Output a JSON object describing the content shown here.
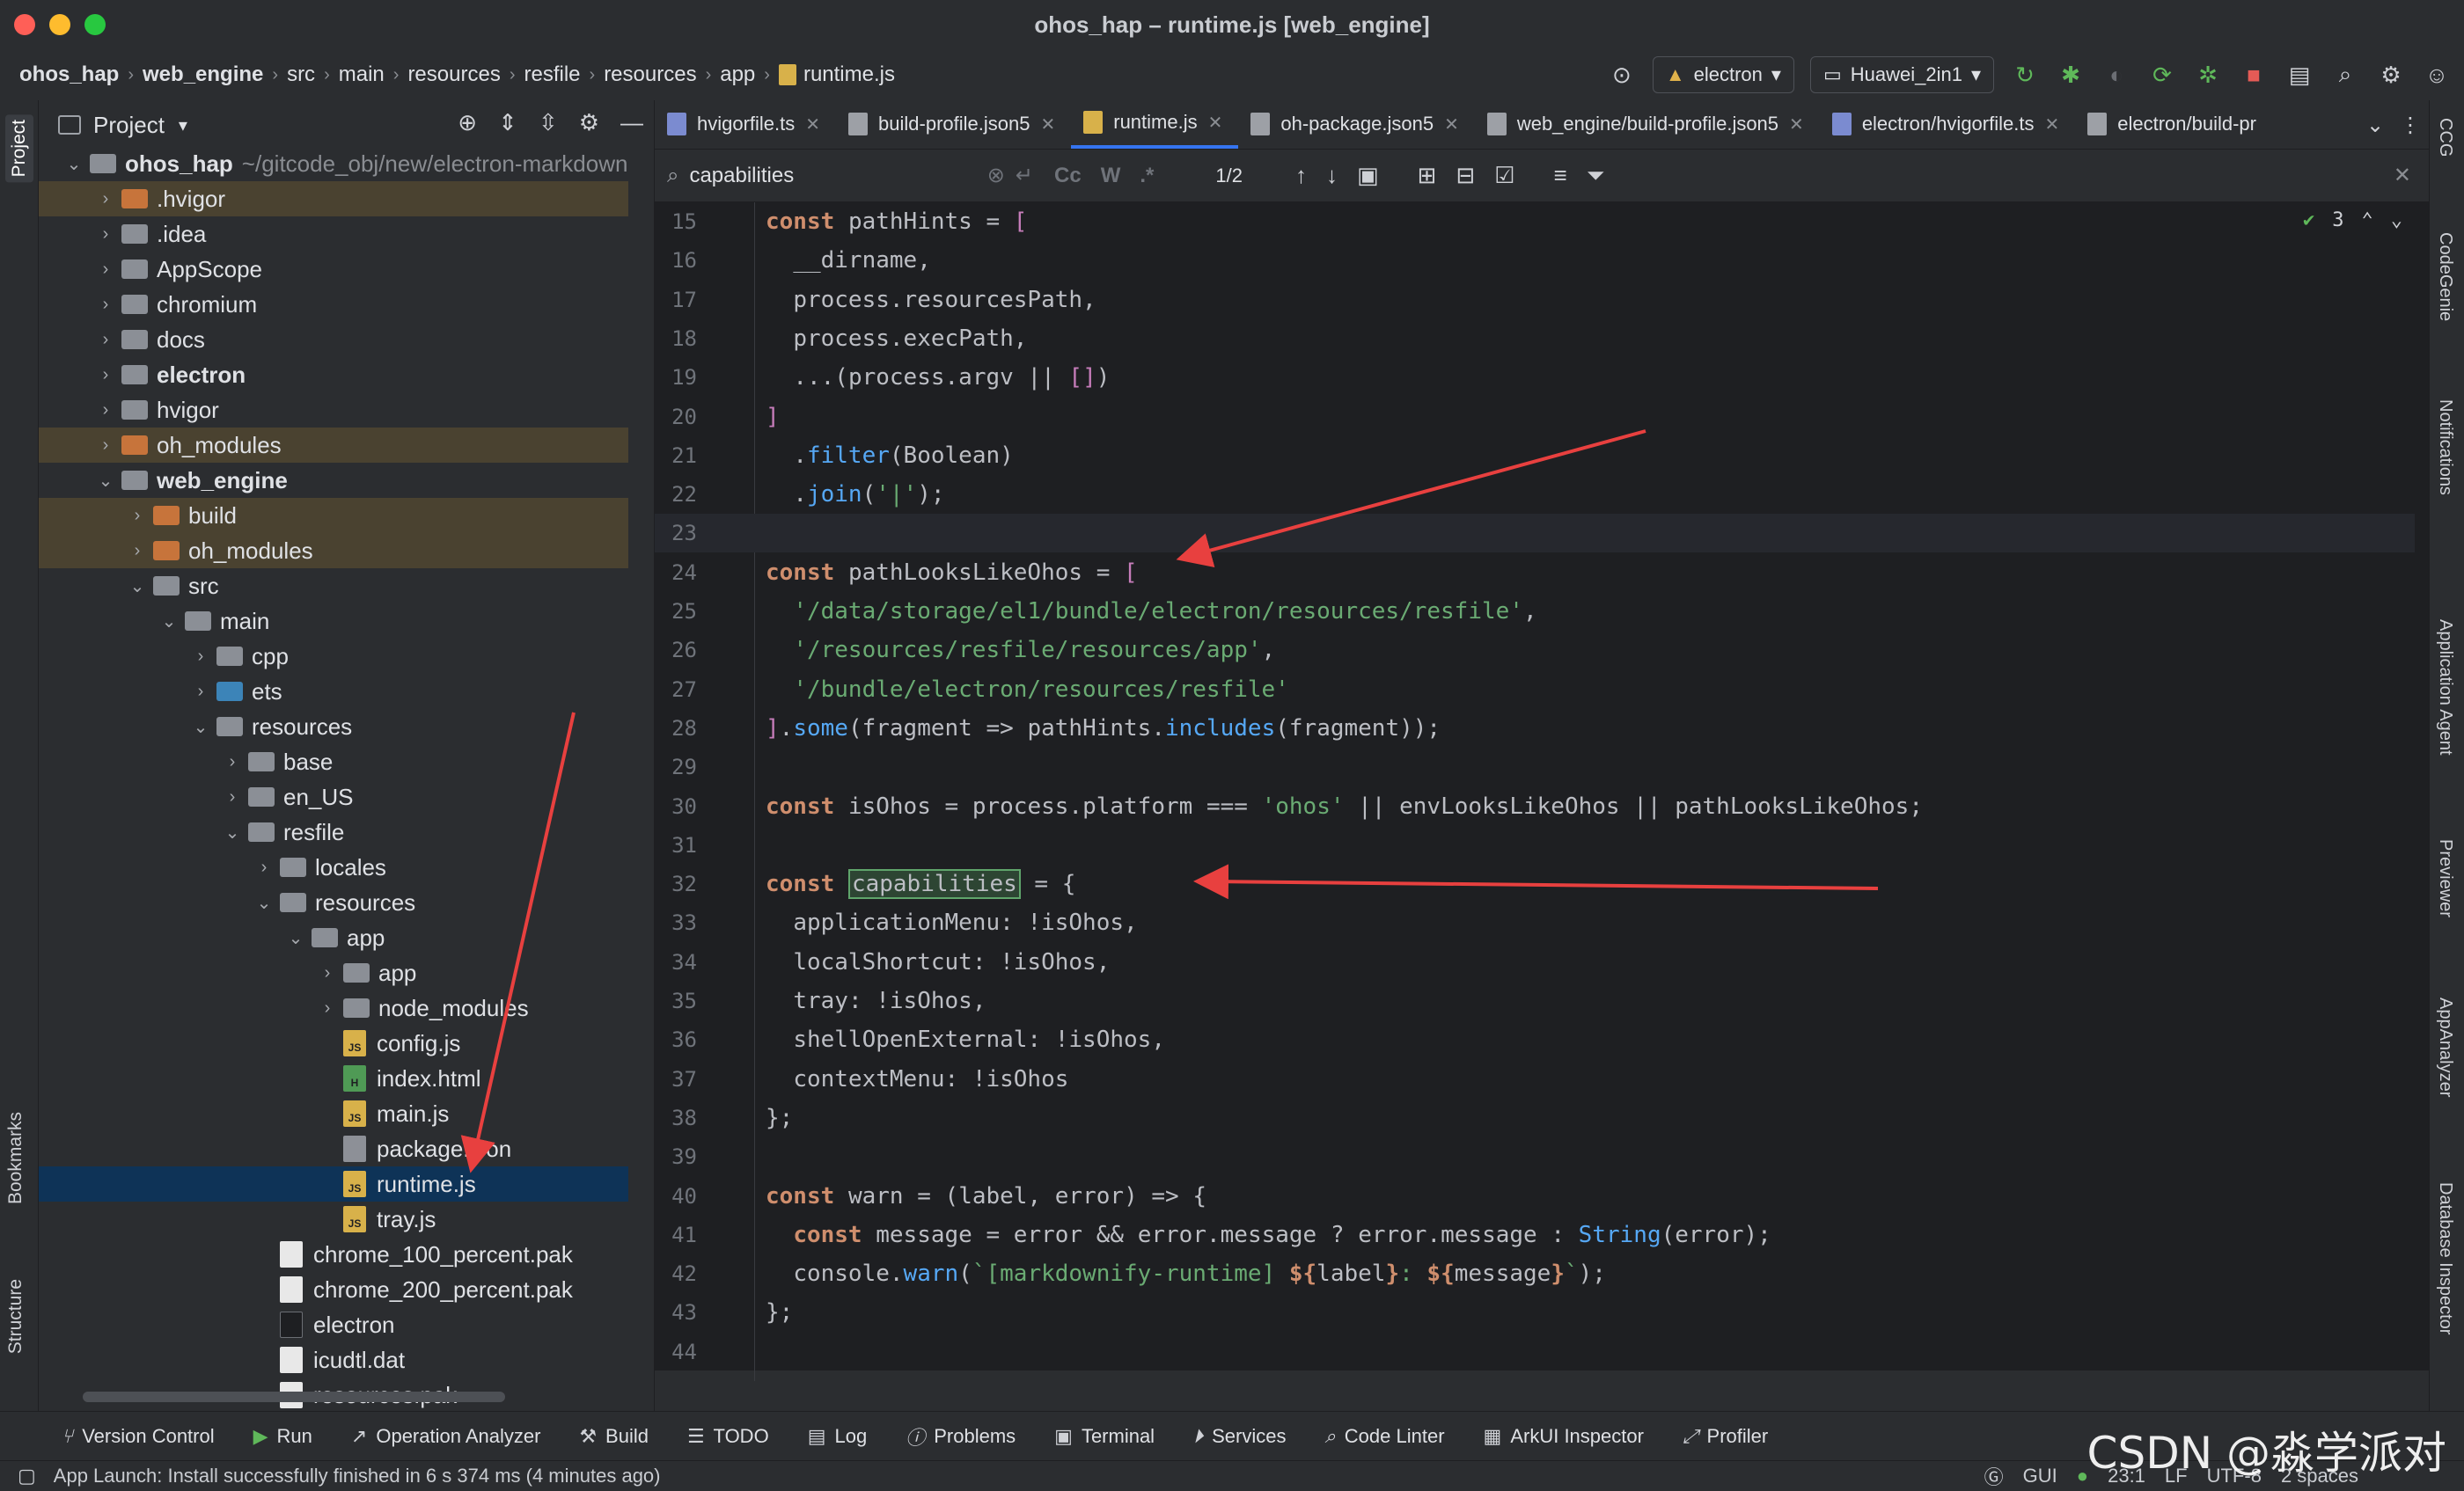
{
  "window": {
    "title": "ohos_hap – runtime.js [web_engine]"
  },
  "breadcrumb": [
    "ohos_hap",
    "web_engine",
    "src",
    "main",
    "resources",
    "resfile",
    "resources",
    "app",
    "runtime.js"
  ],
  "toolbar": {
    "run_config": "electron",
    "device": "Huawei_2in1"
  },
  "left_strip": {
    "project": "Project",
    "bookmarks": "Bookmarks",
    "structure": "Structure"
  },
  "project_panel": {
    "title": "Project",
    "root_name": "ohos_hap",
    "root_path": "~/gitcode_obj/new/electron-markdown",
    "items": [
      {
        "label": "ohos_hap",
        "bold": true
      },
      {
        "label": ".hvigor"
      },
      {
        "label": ".idea"
      },
      {
        "label": "AppScope"
      },
      {
        "label": "chromium"
      },
      {
        "label": "docs"
      },
      {
        "label": "electron",
        "bold": true
      },
      {
        "label": "hvigor"
      },
      {
        "label": "oh_modules"
      },
      {
        "label": "web_engine",
        "bold": true
      },
      {
        "label": "build"
      },
      {
        "label": "oh_modules"
      },
      {
        "label": "src"
      },
      {
        "label": "main"
      },
      {
        "label": "cpp"
      },
      {
        "label": "ets"
      },
      {
        "label": "resources"
      },
      {
        "label": "base"
      },
      {
        "label": "en_US"
      },
      {
        "label": "resfile"
      },
      {
        "label": "locales"
      },
      {
        "label": "resources"
      },
      {
        "label": "app"
      },
      {
        "label": "app"
      },
      {
        "label": "node_modules"
      },
      {
        "label": "config.js"
      },
      {
        "label": "index.html"
      },
      {
        "label": "main.js"
      },
      {
        "label": "package.json"
      },
      {
        "label": "runtime.js"
      },
      {
        "label": "tray.js"
      },
      {
        "label": "chrome_100_percent.pak"
      },
      {
        "label": "chrome_200_percent.pak"
      },
      {
        "label": "electron"
      },
      {
        "label": "icudtl.dat"
      },
      {
        "label": "resources.pak"
      }
    ],
    "file_badges": {
      "js": "JS",
      "html": "H"
    }
  },
  "tabs": [
    {
      "label": "hvigorfile.ts"
    },
    {
      "label": "build-profile.json5"
    },
    {
      "label": "runtime.js",
      "active": true
    },
    {
      "label": "oh-package.json5"
    },
    {
      "label": "web_engine/build-profile.json5"
    },
    {
      "label": "electron/hvigorfile.ts"
    },
    {
      "label": "electron/build-pr"
    }
  ],
  "find": {
    "query": "capabilities",
    "count": "1/2",
    "opt_case": "Cc",
    "opt_word": "W",
    "opt_regex": ".*"
  },
  "inspection": {
    "count": "3"
  },
  "code_lines": [
    {
      "n": "15"
    },
    {
      "n": "16"
    },
    {
      "n": "17"
    },
    {
      "n": "18"
    },
    {
      "n": "19"
    },
    {
      "n": "20"
    },
    {
      "n": "21"
    },
    {
      "n": "22"
    },
    {
      "n": "23"
    },
    {
      "n": "24"
    },
    {
      "n": "25"
    },
    {
      "n": "26"
    },
    {
      "n": "27"
    },
    {
      "n": "28"
    },
    {
      "n": "29"
    },
    {
      "n": "30"
    },
    {
      "n": "31"
    },
    {
      "n": "32"
    },
    {
      "n": "33"
    },
    {
      "n": "34"
    },
    {
      "n": "35"
    },
    {
      "n": "36"
    },
    {
      "n": "37"
    },
    {
      "n": "38"
    },
    {
      "n": "39"
    },
    {
      "n": "40"
    },
    {
      "n": "41"
    },
    {
      "n": "42"
    },
    {
      "n": "43"
    },
    {
      "n": "44"
    }
  ],
  "code": {
    "t": {
      "const": "const",
      "pathHints": "pathHints",
      "eq": " = ",
      "lb": "[",
      "dirname": "__dirname",
      "comma": ",",
      "process": "process",
      "resourcesPath": "resourcesPath",
      "dot": ".",
      "execPath": "execPath",
      "spread": "...(",
      "argv": "argv",
      "or": " || ",
      "emptyarr": "[]",
      "rp": ")",
      "rb": "]",
      "filter": "filter",
      "lp": "(",
      "Boolean": "Boolean",
      "join": "join",
      "pipe": "'|'",
      "end": ");",
      "pathLooksLikeOhos": "pathLooksLikeOhos",
      "s1": "'/data/storage/el1/bundle/electron/resources/resfile'",
      "s2": "'/resources/resfile/resources/app'",
      "s3": "'/bundle/electron/resources/resfile'",
      "some": "some",
      "fragment": "fragment",
      "arrow": " => ",
      "includes": "includes",
      "close": "));",
      "isOhos": "isOhos",
      "platform": "platform",
      "eqq": " === ",
      "ohos": "'ohos'",
      "envLooksLikeOhos": "envLooksLikeOhos",
      "semi": ";",
      "capabilities": "capabilities",
      "lbrace": "{",
      "applicationMenu": "applicationMenu",
      "colon": ": ",
      "not": "!",
      "localShortcut": "localShortcut",
      "tray": "tray",
      "shellOpenExternal": "shellOpenExternal",
      "contextMenu": "contextMenu",
      "rbsemi": "};",
      "warn": "warn",
      "label": "label",
      "error": "error",
      "message": "message",
      "and": " && ",
      "q": " ? ",
      "c": " : ",
      "String": "String",
      "console": "console",
      "tplA": "`[markdownify-runtime] ",
      "tplL": "${",
      "tplR": "}",
      "tplColon": ": ",
      "tplEnd": "`",
      "argsOpen": " = (",
      "argsClose": ") => {",
      "comma2": ", "
    }
  },
  "right_strip": [
    "CCG",
    "CodeGenie",
    "Notifications",
    "Application Agent",
    "Previewer",
    "AppAnalyzer",
    "Database Inspector"
  ],
  "tool_windows": [
    "Version Control",
    "Run",
    "Operation Analyzer",
    "Build",
    "TODO",
    "Log",
    "Problems",
    "Terminal",
    "Services",
    "Code Linter",
    "ArkUI Inspector",
    "Profiler"
  ],
  "status": {
    "message": "App Launch: Install successfully finished in 6 s 374 ms (4 minutes ago)",
    "gui": "GUI",
    "position": "23:1",
    "line_sep": "LF",
    "encoding": "UTF-8",
    "indent": "2 spaces"
  },
  "watermark": "CSDN @淼学派对",
  "colors": {
    "accent": "#3574f0",
    "arrow": "#e8403f",
    "selection": "#0e3357"
  }
}
